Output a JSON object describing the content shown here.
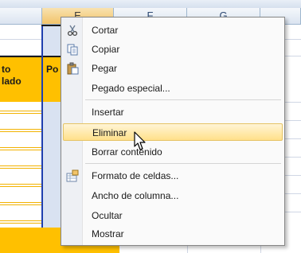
{
  "column_headers": [
    {
      "label": "E",
      "selected": true
    },
    {
      "label": "F",
      "selected": false
    },
    {
      "label": "G",
      "selected": false
    }
  ],
  "cells": {
    "left_line1": "to",
    "left_line2": "lado",
    "e_header_partial": "Po"
  },
  "context_menu": {
    "items": [
      {
        "label": "Cortar",
        "icon": "scissors-icon"
      },
      {
        "label": "Copiar",
        "icon": "copy-icon"
      },
      {
        "label": "Pegar",
        "icon": "paste-icon"
      },
      {
        "label": "Pegado especial...",
        "icon": ""
      },
      {
        "label": "Insertar",
        "icon": ""
      },
      {
        "label": "Eliminar",
        "icon": "",
        "highlighted": true
      },
      {
        "label": "Borrar contenido",
        "icon": ""
      },
      {
        "label": "Formato de celdas...",
        "icon": "format-cells-icon"
      },
      {
        "label": "Ancho de columna...",
        "icon": ""
      },
      {
        "label": "Ocultar",
        "icon": ""
      },
      {
        "label": "Mostrar",
        "icon": ""
      }
    ]
  },
  "colors": {
    "highlight": "#ffe08a",
    "cell_fill": "#ffc000",
    "selection_border": "#1f3fae"
  }
}
